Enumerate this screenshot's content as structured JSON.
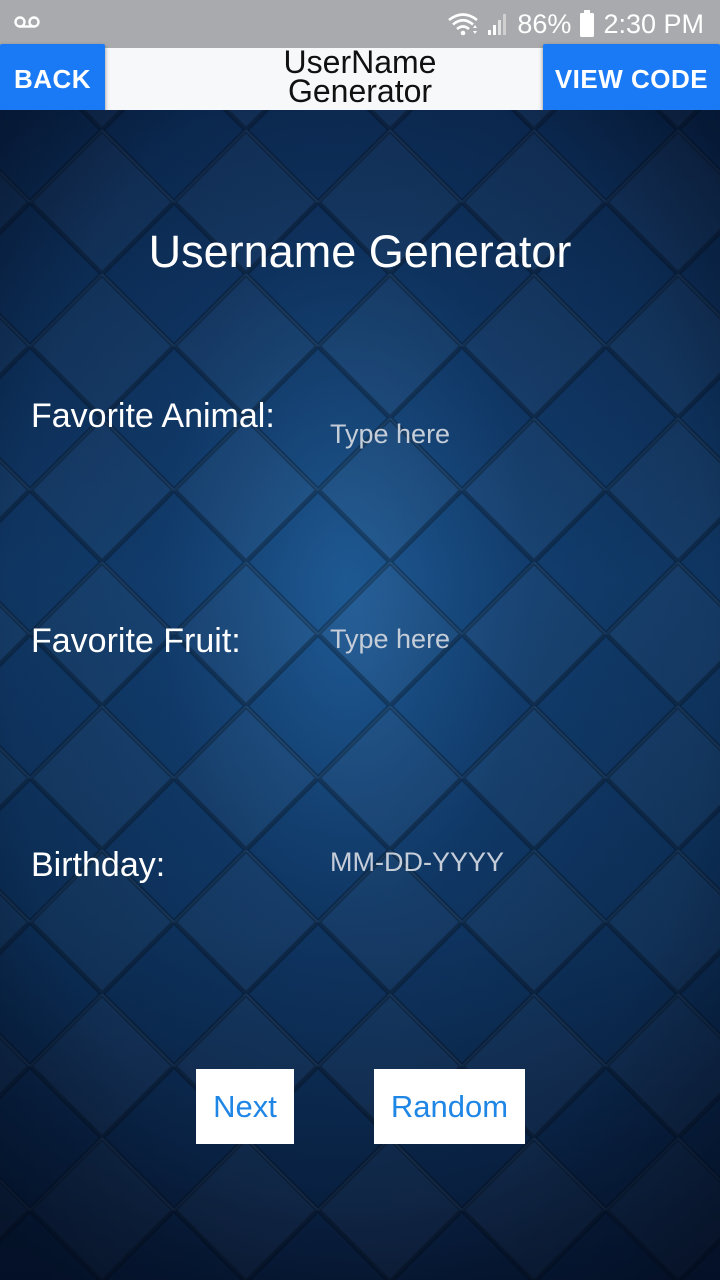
{
  "status_bar": {
    "left_icon": "voicemail-icon",
    "wifi_icon": "wifi-icon",
    "signal_icon": "signal-icon",
    "battery_percent": "86%",
    "battery_icon": "battery-icon",
    "time": "2:30 PM"
  },
  "title_bar": {
    "title_line1": "UserName",
    "title_line2": "Generator",
    "back_label": "BACK",
    "view_code_label": "VIEW CODE"
  },
  "colors": {
    "accent_button": "#1a7af5",
    "action_text": "#1f86e6",
    "status_bar": "#a9aaad"
  },
  "form": {
    "heading": "Username Generator",
    "animal": {
      "label": "Favorite Animal:",
      "placeholder": "Type here",
      "value": ""
    },
    "fruit": {
      "label": "Favorite Fruit:",
      "placeholder": "Type here",
      "value": ""
    },
    "birthday": {
      "label": "Birthday:",
      "placeholder": "MM-DD-YYYY",
      "value": ""
    },
    "next_label": "Next",
    "random_label": "Random"
  }
}
